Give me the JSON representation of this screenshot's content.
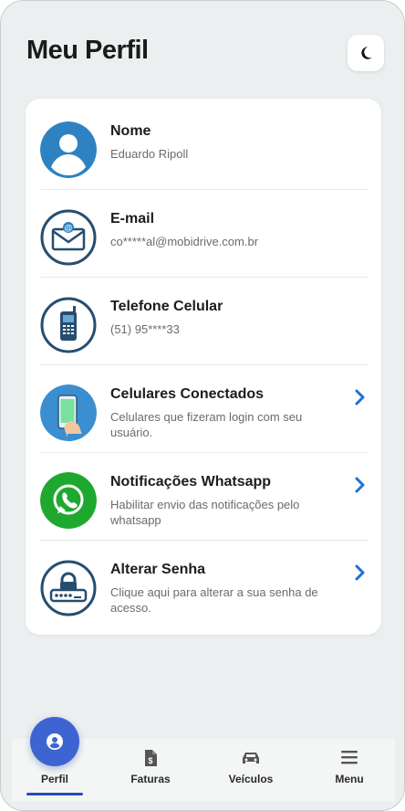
{
  "header": {
    "title": "Meu Perfil",
    "theme_icon": "moon-icon"
  },
  "profile_items": [
    {
      "title": "Nome",
      "subtitle": "Eduardo Ripoll",
      "icon": "user-icon",
      "has_chevron": false
    },
    {
      "title": "E-mail",
      "subtitle": "co*****al@mobidrive.com.br",
      "icon": "email-icon",
      "has_chevron": false
    },
    {
      "title": "Telefone Celular",
      "subtitle": "(51) 95****33",
      "icon": "phone-icon",
      "has_chevron": false
    },
    {
      "title": "Celulares Conectados",
      "subtitle": "Celulares que fizeram login com seu usuário.",
      "icon": "smartphone-hand-icon",
      "has_chevron": true
    },
    {
      "title": "Notificações Whatsapp",
      "subtitle": "Habilitar envio das notificações pelo whatsapp",
      "icon": "whatsapp-icon",
      "has_chevron": true
    },
    {
      "title": "Alterar Senha",
      "subtitle": "Clique aqui para alterar a sua senha de acesso.",
      "icon": "password-lock-icon",
      "has_chevron": true
    }
  ],
  "bottom_nav": {
    "items": [
      {
        "label": "Perfil",
        "icon": "profile-icon",
        "active": true
      },
      {
        "label": "Faturas",
        "icon": "invoice-icon",
        "active": false
      },
      {
        "label": "Veículos",
        "icon": "car-icon",
        "active": false
      },
      {
        "label": "Menu",
        "icon": "menu-icon",
        "active": false
      }
    ]
  },
  "colors": {
    "background": "#eceff0",
    "accent": "#3d64d1",
    "chevron": "#1f6fd8",
    "icon_blue": "#2f7fc0",
    "icon_navy": "#264d6f",
    "whatsapp_green": "#1fa82f"
  }
}
